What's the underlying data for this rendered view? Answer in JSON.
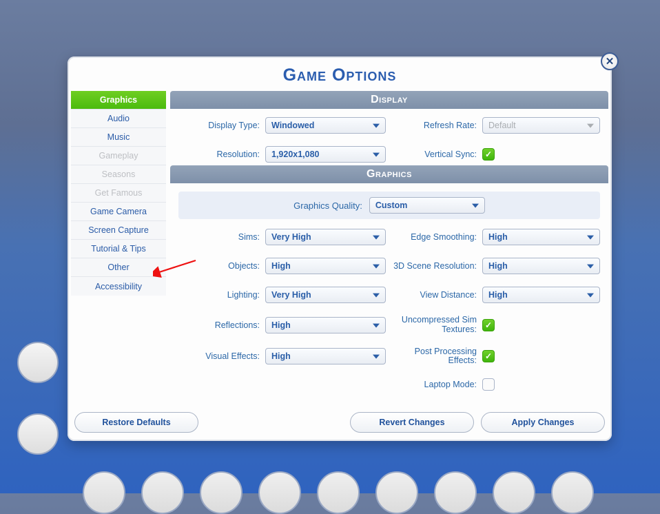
{
  "dialog_title": "Game Options",
  "sidebar": {
    "items": [
      {
        "label": "Graphics",
        "active": true,
        "disabled": false
      },
      {
        "label": "Audio",
        "active": false,
        "disabled": false
      },
      {
        "label": "Music",
        "active": false,
        "disabled": false
      },
      {
        "label": "Gameplay",
        "active": false,
        "disabled": true
      },
      {
        "label": "Seasons",
        "active": false,
        "disabled": true
      },
      {
        "label": "Get Famous",
        "active": false,
        "disabled": true
      },
      {
        "label": "Game Camera",
        "active": false,
        "disabled": false
      },
      {
        "label": "Screen Capture",
        "active": false,
        "disabled": false
      },
      {
        "label": "Tutorial & Tips",
        "active": false,
        "disabled": false
      },
      {
        "label": "Other",
        "active": false,
        "disabled": false
      },
      {
        "label": "Accessibility",
        "active": false,
        "disabled": false
      }
    ]
  },
  "display": {
    "header": "Display",
    "display_type": {
      "label": "Display Type:",
      "value": "Windowed"
    },
    "refresh_rate": {
      "label": "Refresh Rate:",
      "value": "Default",
      "disabled": true
    },
    "resolution": {
      "label": "Resolution:",
      "value": "1,920x1,080"
    },
    "vertical_sync": {
      "label": "Vertical Sync:",
      "checked": true
    }
  },
  "graphics": {
    "header": "Graphics",
    "quality": {
      "label": "Graphics Quality:",
      "value": "Custom"
    },
    "sims": {
      "label": "Sims:",
      "value": "Very High"
    },
    "edge_smoothing": {
      "label": "Edge Smoothing:",
      "value": "High"
    },
    "objects": {
      "label": "Objects:",
      "value": "High"
    },
    "scene_resolution": {
      "label": "3D Scene Resolution:",
      "value": "High"
    },
    "lighting": {
      "label": "Lighting:",
      "value": "Very High"
    },
    "view_distance": {
      "label": "View Distance:",
      "value": "High"
    },
    "reflections": {
      "label": "Reflections:",
      "value": "High"
    },
    "uncompressed_textures": {
      "label": "Uncompressed Sim Textures:",
      "checked": true
    },
    "visual_effects": {
      "label": "Visual Effects:",
      "value": "High"
    },
    "post_processing": {
      "label": "Post Processing Effects:",
      "checked": true
    },
    "laptop_mode": {
      "label": "Laptop Mode:",
      "checked": false
    }
  },
  "buttons": {
    "restore": "Restore Defaults",
    "revert": "Revert Changes",
    "apply": "Apply Changes"
  }
}
